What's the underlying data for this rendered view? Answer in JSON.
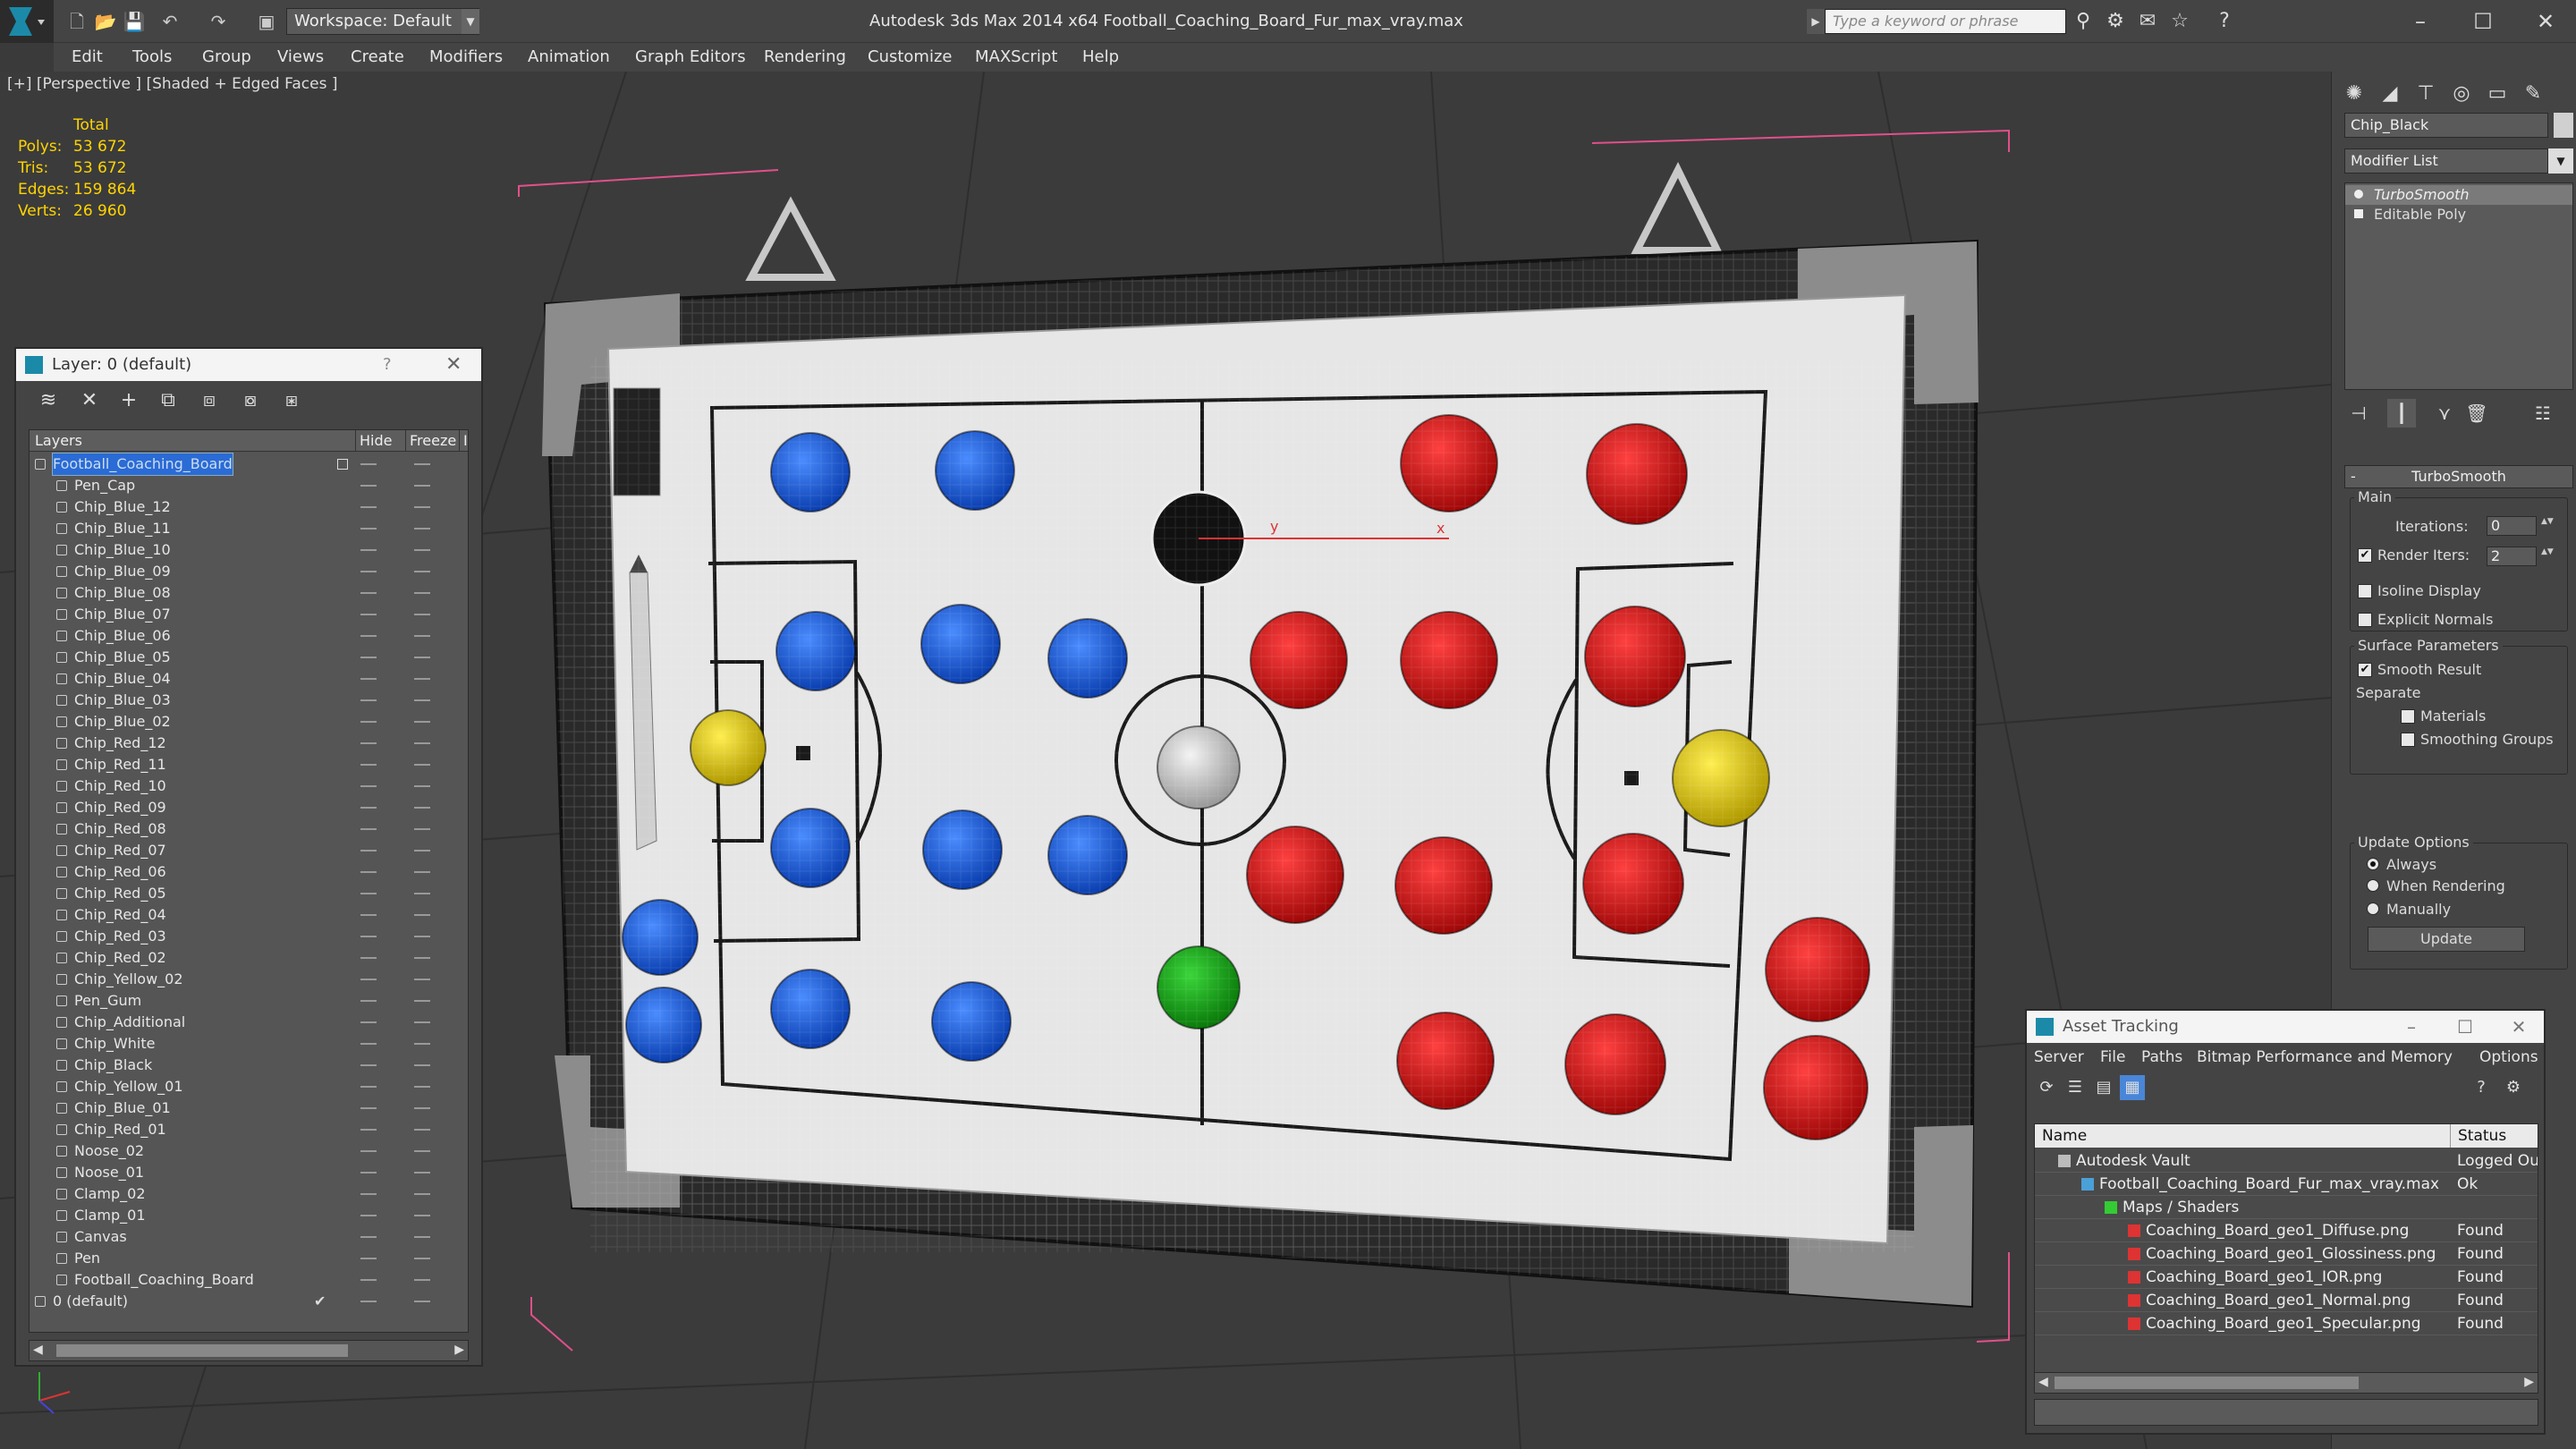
{
  "app": {
    "title": "Autodesk 3ds Max  2014 x64      Football_Coaching_Board_Fur_max_vray.max",
    "workspace": "Workspace: Default",
    "search_placeholder": "Type a keyword or phrase"
  },
  "menu": [
    "Edit",
    "Tools",
    "Group",
    "Views",
    "Create",
    "Modifiers",
    "Animation",
    "Graph Editors",
    "Rendering",
    "Customize",
    "MAXScript",
    "Help"
  ],
  "viewport": {
    "label": "[+] [Perspective ] [Shaded + Edged Faces ]",
    "stats": {
      "total": "Total",
      "rows": [
        {
          "label": "Polys:",
          "value": "53 672"
        },
        {
          "label": "Tris:",
          "value": "53 672"
        },
        {
          "label": "Edges:",
          "value": "159 864"
        },
        {
          "label": "Verts:",
          "value": "26 960"
        }
      ]
    },
    "gizmo_y": "y",
    "gizmo_x": "x"
  },
  "layer_panel": {
    "title": "Layer: 0 (default)",
    "help": "?",
    "col_layers": "Layers",
    "col_hide": "Hide",
    "col_freeze": "Freeze",
    "col_extra": "I",
    "rows": [
      {
        "name": "Football_Coaching_Board",
        "level": 0,
        "selected": true
      },
      {
        "name": "Pen_Cap",
        "level": 1
      },
      {
        "name": "Chip_Blue_12",
        "level": 1
      },
      {
        "name": "Chip_Blue_11",
        "level": 1
      },
      {
        "name": "Chip_Blue_10",
        "level": 1
      },
      {
        "name": "Chip_Blue_09",
        "level": 1
      },
      {
        "name": "Chip_Blue_08",
        "level": 1
      },
      {
        "name": "Chip_Blue_07",
        "level": 1
      },
      {
        "name": "Chip_Blue_06",
        "level": 1
      },
      {
        "name": "Chip_Blue_05",
        "level": 1
      },
      {
        "name": "Chip_Blue_04",
        "level": 1
      },
      {
        "name": "Chip_Blue_03",
        "level": 1
      },
      {
        "name": "Chip_Blue_02",
        "level": 1
      },
      {
        "name": "Chip_Red_12",
        "level": 1
      },
      {
        "name": "Chip_Red_11",
        "level": 1
      },
      {
        "name": "Chip_Red_10",
        "level": 1
      },
      {
        "name": "Chip_Red_09",
        "level": 1
      },
      {
        "name": "Chip_Red_08",
        "level": 1
      },
      {
        "name": "Chip_Red_07",
        "level": 1
      },
      {
        "name": "Chip_Red_06",
        "level": 1
      },
      {
        "name": "Chip_Red_05",
        "level": 1
      },
      {
        "name": "Chip_Red_04",
        "level": 1
      },
      {
        "name": "Chip_Red_03",
        "level": 1
      },
      {
        "name": "Chip_Red_02",
        "level": 1
      },
      {
        "name": "Chip_Yellow_02",
        "level": 1
      },
      {
        "name": "Pen_Gum",
        "level": 1
      },
      {
        "name": "Chip_Additional",
        "level": 1
      },
      {
        "name": "Chip_White",
        "level": 1
      },
      {
        "name": "Chip_Black",
        "level": 1
      },
      {
        "name": "Chip_Yellow_01",
        "level": 1
      },
      {
        "name": "Chip_Blue_01",
        "level": 1
      },
      {
        "name": "Chip_Red_01",
        "level": 1
      },
      {
        "name": "Noose_02",
        "level": 1
      },
      {
        "name": "Noose_01",
        "level": 1
      },
      {
        "name": "Clamp_02",
        "level": 1
      },
      {
        "name": "Clamp_01",
        "level": 1
      },
      {
        "name": "Canvas",
        "level": 1
      },
      {
        "name": "Pen",
        "level": 1
      },
      {
        "name": "Football_Coaching_Board",
        "level": 1
      },
      {
        "name": "0 (default)",
        "level": 0,
        "current": true
      }
    ]
  },
  "command_panel": {
    "object_name": "Chip_Black",
    "modifier_list": "Modifier List",
    "stack": [
      "TurboSmooth",
      "Editable Poly"
    ],
    "rollout_title": "TurboSmooth",
    "main_label": "Main",
    "iterations_label": "Iterations:",
    "iterations": "0",
    "render_iters_label": "Render Iters:",
    "render_iters": "2",
    "isoline": "Isoline Display",
    "explicit_normals": "Explicit Normals",
    "surface_params": "Surface Parameters",
    "smooth_result": "Smooth Result",
    "separate": "Separate",
    "materials": "Materials",
    "smoothing_groups": "Smoothing Groups",
    "update_options": "Update Options",
    "always": "Always",
    "when_rendering": "When Rendering",
    "manually": "Manually",
    "update": "Update"
  },
  "asset_tracking": {
    "title": "Asset Tracking",
    "menu": [
      "Server",
      "File",
      "Paths",
      "Bitmap Performance and Memory",
      "Options"
    ],
    "col_name": "Name",
    "col_status": "Status",
    "rows": [
      {
        "name": "Autodesk Vault",
        "status": "Logged Ou",
        "indent": 0,
        "icon": "vault"
      },
      {
        "name": "Football_Coaching_Board_Fur_max_vray.max",
        "status": "Ok",
        "indent": 1,
        "icon": "max-file"
      },
      {
        "name": "Maps / Shaders",
        "status": "",
        "indent": 2,
        "icon": "maps"
      },
      {
        "name": "Coaching_Board_geo1_Diffuse.png",
        "status": "Found",
        "indent": 3,
        "icon": "png"
      },
      {
        "name": "Coaching_Board_geo1_Glossiness.png",
        "status": "Found",
        "indent": 3,
        "icon": "png"
      },
      {
        "name": "Coaching_Board_geo1_IOR.png",
        "status": "Found",
        "indent": 3,
        "icon": "png"
      },
      {
        "name": "Coaching_Board_geo1_Normal.png",
        "status": "Found",
        "indent": 3,
        "icon": "png"
      },
      {
        "name": "Coaching_Board_geo1_Specular.png",
        "status": "Found",
        "indent": 3,
        "icon": "png"
      }
    ]
  },
  "colors": {
    "stats": "#ffd400",
    "chip_blue": "#1f63e6",
    "chip_red": "#e01515",
    "chip_yellow": "#e8d418",
    "chip_green": "#1aa81a",
    "chip_white": "#d8d8d8",
    "chip_black": "#111111",
    "selection_pink": "#e0508a"
  }
}
